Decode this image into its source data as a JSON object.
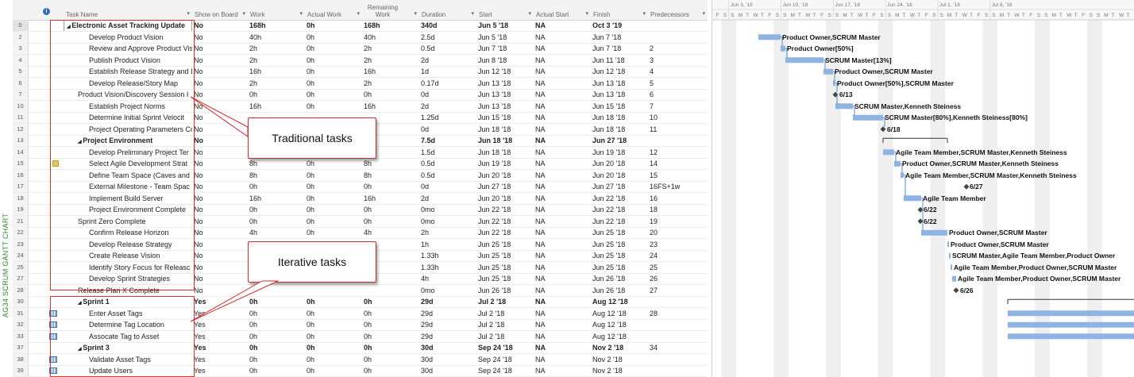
{
  "sidebar": {
    "label": "AG34 SCRUM GANTT CHART"
  },
  "columns": {
    "info": "i",
    "task_name": "Task Name",
    "show_on_board": "Show on Board",
    "work": "Work",
    "actual_work": "Actual Work",
    "remaining_work": "Remaining Work",
    "duration": "Duration",
    "start": "Start",
    "actual_start": "Actual Start",
    "finish": "Finish",
    "predecessors": "Predecessors"
  },
  "rows": [
    {
      "id": "0",
      "name": "Electronic Asset Tracking Update",
      "indent": 0,
      "summary": true,
      "show": "No",
      "work": "168h",
      "actual_work": "0h",
      "remaining": "168h",
      "duration": "340d",
      "start": "Jun 5 '18",
      "actual_start": "NA",
      "finish": "Oct 3 '19",
      "pred": "",
      "icon": ""
    },
    {
      "id": "2",
      "name": "Develop Product Vision",
      "indent": 2,
      "summary": false,
      "show": "No",
      "work": "40h",
      "actual_work": "0h",
      "remaining": "40h",
      "duration": "2.5d",
      "start": "Jun 5 '18",
      "actual_start": "NA",
      "finish": "Jun 7 '18",
      "pred": "",
      "icon": ""
    },
    {
      "id": "3",
      "name": "Review and Approve Product Vis",
      "indent": 2,
      "summary": false,
      "show": "No",
      "work": "2h",
      "actual_work": "0h",
      "remaining": "2h",
      "duration": "0.5d",
      "start": "Jun 7 '18",
      "actual_start": "NA",
      "finish": "Jun 7 '18",
      "pred": "2",
      "icon": ""
    },
    {
      "id": "4",
      "name": "Publish Product Vision",
      "indent": 2,
      "summary": false,
      "show": "No",
      "work": "2h",
      "actual_work": "0h",
      "remaining": "2h",
      "duration": "2d",
      "start": "Jun 8 '18",
      "actual_start": "NA",
      "finish": "Jun 11 '18",
      "pred": "3",
      "icon": ""
    },
    {
      "id": "5",
      "name": "Establish Release Strategy and Dr",
      "indent": 2,
      "summary": false,
      "show": "No",
      "work": "16h",
      "actual_work": "0h",
      "remaining": "16h",
      "duration": "1d",
      "start": "Jun 12 '18",
      "actual_start": "NA",
      "finish": "Jun 12 '18",
      "pred": "4",
      "icon": ""
    },
    {
      "id": "6",
      "name": "Develop Release/Story Map",
      "indent": 2,
      "summary": false,
      "show": "No",
      "work": "2h",
      "actual_work": "0h",
      "remaining": "2h",
      "duration": "0.17d",
      "start": "Jun 13 '18",
      "actual_start": "NA",
      "finish": "Jun 13 '18",
      "pred": "5",
      "icon": ""
    },
    {
      "id": "7",
      "name": "Product Vision/Discovery Session I",
      "indent": 1,
      "summary": false,
      "show": "No",
      "work": "0h",
      "actual_work": "0h",
      "remaining": "0h",
      "duration": "0d",
      "start": "Jun 13 '18",
      "actual_start": "NA",
      "finish": "Jun 13 '18",
      "pred": "6",
      "icon": ""
    },
    {
      "id": "10",
      "name": "Establish Project Norms",
      "indent": 2,
      "summary": false,
      "show": "No",
      "work": "16h",
      "actual_work": "0h",
      "remaining": "16h",
      "duration": "2d",
      "start": "Jun 13 '18",
      "actual_start": "NA",
      "finish": "Jun 15 '18",
      "pred": "7",
      "icon": ""
    },
    {
      "id": "11",
      "name": "Determine Initial Sprint Velocit",
      "indent": 2,
      "summary": false,
      "show": "No",
      "work": "",
      "actual_work": "",
      "remaining": "",
      "duration": "1.25d",
      "start": "Jun 15 '18",
      "actual_start": "NA",
      "finish": "Jun 18 '18",
      "pred": "10",
      "icon": ""
    },
    {
      "id": "12",
      "name": "Project Operating Parameters Co",
      "indent": 2,
      "summary": false,
      "show": "No",
      "work": "",
      "actual_work": "",
      "remaining": "",
      "duration": "0d",
      "start": "Jun 18 '18",
      "actual_start": "NA",
      "finish": "Jun 18 '18",
      "pred": "11",
      "icon": ""
    },
    {
      "id": "13",
      "name": "Project Environment",
      "indent": 1,
      "summary": true,
      "show": "No",
      "work": "",
      "actual_work": "",
      "remaining": "",
      "duration": "7.5d",
      "start": "Jun 18 '18",
      "actual_start": "NA",
      "finish": "Jun 27 '18",
      "pred": "",
      "icon": ""
    },
    {
      "id": "14",
      "name": "Develop Preliminary Project Ter",
      "indent": 2,
      "summary": false,
      "show": "No",
      "work": "",
      "actual_work": "",
      "remaining": "",
      "duration": "1.5d",
      "start": "Jun 18 '18",
      "actual_start": "NA",
      "finish": "Jun 19 '18",
      "pred": "12",
      "icon": ""
    },
    {
      "id": "15",
      "name": "Select Agile Development Strat",
      "indent": 2,
      "summary": false,
      "show": "No",
      "work": "8h",
      "actual_work": "0h",
      "remaining": "8h",
      "duration": "0.5d",
      "start": "Jun 19 '18",
      "actual_start": "NA",
      "finish": "Jun 20 '18",
      "pred": "14",
      "icon": "note"
    },
    {
      "id": "16",
      "name": "Define Team Space (Caves and",
      "indent": 2,
      "summary": false,
      "show": "No",
      "work": "8h",
      "actual_work": "0h",
      "remaining": "8h",
      "duration": "0.5d",
      "start": "Jun 20 '18",
      "actual_start": "NA",
      "finish": "Jun 20 '18",
      "pred": "15",
      "icon": ""
    },
    {
      "id": "17",
      "name": "External Milestone - Team Spac",
      "indent": 2,
      "summary": false,
      "show": "No",
      "work": "0h",
      "actual_work": "0h",
      "remaining": "0h",
      "duration": "0d",
      "start": "Jun 27 '18",
      "actual_start": "NA",
      "finish": "Jun 27 '18",
      "pred": "16FS+1w",
      "icon": ""
    },
    {
      "id": "18",
      "name": "Implement Build Server",
      "indent": 2,
      "summary": false,
      "show": "No",
      "work": "16h",
      "actual_work": "0h",
      "remaining": "16h",
      "duration": "2d",
      "start": "Jun 20 '18",
      "actual_start": "NA",
      "finish": "Jun 22 '18",
      "pred": "16",
      "icon": ""
    },
    {
      "id": "19",
      "name": "Project Environment Complete",
      "indent": 2,
      "summary": false,
      "show": "No",
      "work": "0h",
      "actual_work": "0h",
      "remaining": "0h",
      "duration": "0mo",
      "start": "Jun 22 '18",
      "actual_start": "NA",
      "finish": "Jun 22 '18",
      "pred": "18",
      "icon": ""
    },
    {
      "id": "21",
      "name": "Sprint Zero Complete",
      "indent": 1,
      "summary": false,
      "show": "No",
      "work": "0h",
      "actual_work": "0h",
      "remaining": "0h",
      "duration": "0mo",
      "start": "Jun 22 '18",
      "actual_start": "NA",
      "finish": "Jun 22 '18",
      "pred": "19",
      "icon": ""
    },
    {
      "id": "22",
      "name": "Confirm Release Horizon",
      "indent": 2,
      "summary": false,
      "show": "No",
      "work": "4h",
      "actual_work": "0h",
      "remaining": "4h",
      "duration": "2h",
      "start": "Jun 22 '18",
      "actual_start": "NA",
      "finish": "Jun 25 '18",
      "pred": "20",
      "icon": ""
    },
    {
      "id": "23",
      "name": "Develop Release Strategy",
      "indent": 2,
      "summary": false,
      "show": "No",
      "work": "",
      "actual_work": "",
      "remaining": "",
      "duration": "1h",
      "start": "Jun 25 '18",
      "actual_start": "NA",
      "finish": "Jun 25 '18",
      "pred": "23",
      "icon": ""
    },
    {
      "id": "24",
      "name": "Create Release Vision",
      "indent": 2,
      "summary": false,
      "show": "No",
      "work": "",
      "actual_work": "",
      "remaining": "",
      "duration": "1.33h",
      "start": "Jun 25 '18",
      "actual_start": "NA",
      "finish": "Jun 25 '18",
      "pred": "24",
      "icon": ""
    },
    {
      "id": "25",
      "name": "Identify Story Focus for Releasc",
      "indent": 2,
      "summary": false,
      "show": "No",
      "work": "",
      "actual_work": "",
      "remaining": "",
      "duration": "1.33h",
      "start": "Jun 25 '18",
      "actual_start": "NA",
      "finish": "Jun 25 '18",
      "pred": "25",
      "icon": ""
    },
    {
      "id": "27",
      "name": "Develop Sprint Strategies",
      "indent": 2,
      "summary": false,
      "show": "No",
      "work": "",
      "actual_work": "",
      "remaining": "",
      "duration": "4h",
      "start": "Jun 25 '18",
      "actual_start": "NA",
      "finish": "Jun 26 '18",
      "pred": "26",
      "icon": ""
    },
    {
      "id": "28",
      "name": "Release Plan X Complete",
      "indent": 1,
      "summary": false,
      "show": "No",
      "work": "",
      "actual_work": "",
      "remaining": "",
      "duration": "0mo",
      "start": "Jun 26 '18",
      "actual_start": "NA",
      "finish": "Jun 26 '18",
      "pred": "27",
      "icon": ""
    },
    {
      "id": "30",
      "name": "Sprint 1",
      "indent": 1,
      "summary": true,
      "show": "Yes",
      "work": "0h",
      "actual_work": "0h",
      "remaining": "0h",
      "duration": "29d",
      "start": "Jul 2 '18",
      "actual_start": "NA",
      "finish": "Aug 12 '18",
      "pred": "",
      "icon": ""
    },
    {
      "id": "31",
      "name": "Enter Asset Tags",
      "indent": 2,
      "summary": false,
      "show": "Yes",
      "work": "0h",
      "actual_work": "0h",
      "remaining": "0h",
      "duration": "29d",
      "start": "Jul 2 '18",
      "actual_start": "NA",
      "finish": "Aug 12 '18",
      "pred": "28",
      "icon": "grid"
    },
    {
      "id": "32",
      "name": "Determine Tag Location",
      "indent": 2,
      "summary": false,
      "show": "Yes",
      "work": "0h",
      "actual_work": "0h",
      "remaining": "0h",
      "duration": "29d",
      "start": "Jul 2 '18",
      "actual_start": "NA",
      "finish": "Aug 12 '18",
      "pred": "",
      "icon": "grid"
    },
    {
      "id": "33",
      "name": "Assocate Tag to Asset",
      "indent": 2,
      "summary": false,
      "show": "Yes",
      "work": "0h",
      "actual_work": "0h",
      "remaining": "0h",
      "duration": "29d",
      "start": "Jul 2 '18",
      "actual_start": "NA",
      "finish": "Aug 12 '18",
      "pred": "",
      "icon": "grid"
    },
    {
      "id": "37",
      "name": "Sprint 3",
      "indent": 1,
      "summary": true,
      "show": "Yes",
      "work": "0h",
      "actual_work": "0h",
      "remaining": "0h",
      "duration": "30d",
      "start": "Sep 24 '18",
      "actual_start": "NA",
      "finish": "Nov 2 '18",
      "pred": "34",
      "icon": ""
    },
    {
      "id": "38",
      "name": "Validate Asset Tags",
      "indent": 2,
      "summary": false,
      "show": "Yes",
      "work": "0h",
      "actual_work": "0h",
      "remaining": "0h",
      "duration": "30d",
      "start": "Sep 24 '18",
      "actual_start": "NA",
      "finish": "Nov 2 '18",
      "pred": "",
      "icon": "grid"
    },
    {
      "id": "39",
      "name": "Update Users",
      "indent": 2,
      "summary": false,
      "show": "Yes",
      "work": "0h",
      "actual_work": "0h",
      "remaining": "0h",
      "duration": "30d",
      "start": "Sep 24 '18",
      "actual_start": "NA",
      "finish": "Nov 2 '18",
      "pred": "",
      "icon": "grid"
    }
  ],
  "callouts": {
    "traditional": "Traditional tasks",
    "iterative": "Iterative tasks"
  },
  "gantt": {
    "weeks": [
      "Jun 3, '18",
      "Jun 10, '18",
      "Jun 17, '18",
      "Jun 24, '18",
      "Jul 1, '18",
      "Jul 8, '18"
    ],
    "day_letters": [
      "F",
      "S",
      "S",
      "M",
      "T",
      "W",
      "T",
      "F",
      "S",
      "S",
      "M",
      "T",
      "W",
      "T",
      "F",
      "S",
      "S",
      "M",
      "T",
      "W",
      "T",
      "F",
      "S",
      "S",
      "M",
      "T",
      "W",
      "T",
      "F",
      "S",
      "S",
      "M",
      "T",
      "W",
      "T",
      "F",
      "S",
      "S",
      "M",
      "T",
      "W",
      "T",
      "F",
      "S",
      "S",
      "M",
      "T",
      "W",
      "T",
      "F",
      "S",
      "S",
      "M",
      "T",
      "W",
      "T"
    ],
    "bar_color": "#8fb4e3",
    "labels": [
      {
        "row": 1,
        "text": "Product Owner,SCRUM Master"
      },
      {
        "row": 2,
        "text": "Product Owner[50%]"
      },
      {
        "row": 3,
        "text": "SCRUM Master[13%]"
      },
      {
        "row": 4,
        "text": "Product Owner,SCRUM Master"
      },
      {
        "row": 5,
        "text": "Product Owner[50%],SCRUM Master"
      },
      {
        "row": 6,
        "text": "6/13"
      },
      {
        "row": 7,
        "text": "SCRUM Master,Kenneth Steiness"
      },
      {
        "row": 8,
        "text": "SCRUM Master[80%],Kenneth Steiness[80%]"
      },
      {
        "row": 9,
        "text": "6/18"
      },
      {
        "row": 11,
        "text": "Agile Team Member,SCRUM Master,Kenneth Steiness"
      },
      {
        "row": 12,
        "text": "Product Owner,SCRUM Master,Kenneth Steiness"
      },
      {
        "row": 13,
        "text": "Agile Team Member,SCRUM Master,Kenneth Steiness"
      },
      {
        "row": 14,
        "text": "6/27"
      },
      {
        "row": 15,
        "text": "Agile Team Member"
      },
      {
        "row": 16,
        "text": "6/22"
      },
      {
        "row": 17,
        "text": "6/22"
      },
      {
        "row": 18,
        "text": "Product Owner,SCRUM Master"
      },
      {
        "row": 19,
        "text": "Product Owner,SCRUM Master"
      },
      {
        "row": 20,
        "text": "SCRUM Master,Agile Team Member,Product Owner"
      },
      {
        "row": 21,
        "text": "Agile Team Member,Product Owner,SCRUM Master"
      },
      {
        "row": 22,
        "text": "Agile Team Member,Product Owner,SCRUM Master"
      },
      {
        "row": 23,
        "text": "6/26"
      }
    ]
  }
}
